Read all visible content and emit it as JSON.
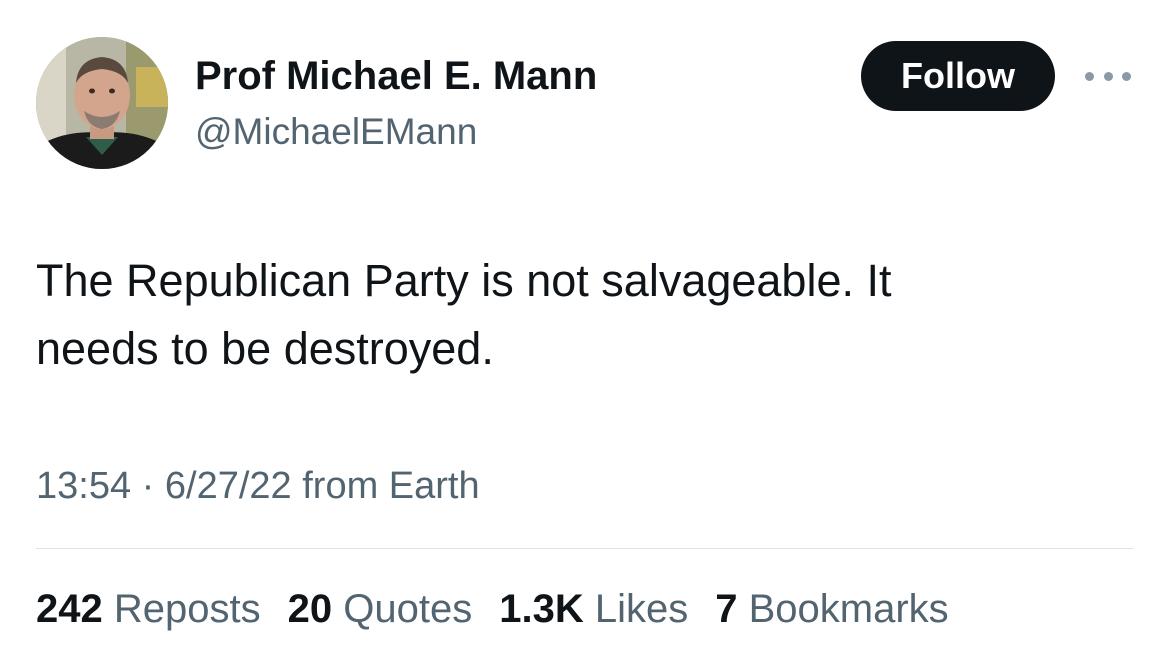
{
  "author": {
    "display_name": "Prof Michael E. Mann",
    "handle": "@MichaelEMann"
  },
  "follow_button": {
    "label": "Follow"
  },
  "more_icon": "ellipsis-icon",
  "tweet": {
    "text_line1": "The Republican Party is not salvageable. It",
    "text_line2": "needs to be destroyed.",
    "time": "13:54",
    "separator": "·",
    "date": "6/27/22",
    "source": "from Earth"
  },
  "stats": [
    {
      "count": "242",
      "label": "Reposts"
    },
    {
      "count": "20",
      "label": "Quotes"
    },
    {
      "count": "1.3K",
      "label": "Likes"
    },
    {
      "count": "7",
      "label": "Bookmarks"
    }
  ],
  "colors": {
    "text_primary": "#0f1419",
    "text_secondary": "#536471",
    "button_bg": "#0f1419",
    "divider": "#dfe3e6"
  }
}
